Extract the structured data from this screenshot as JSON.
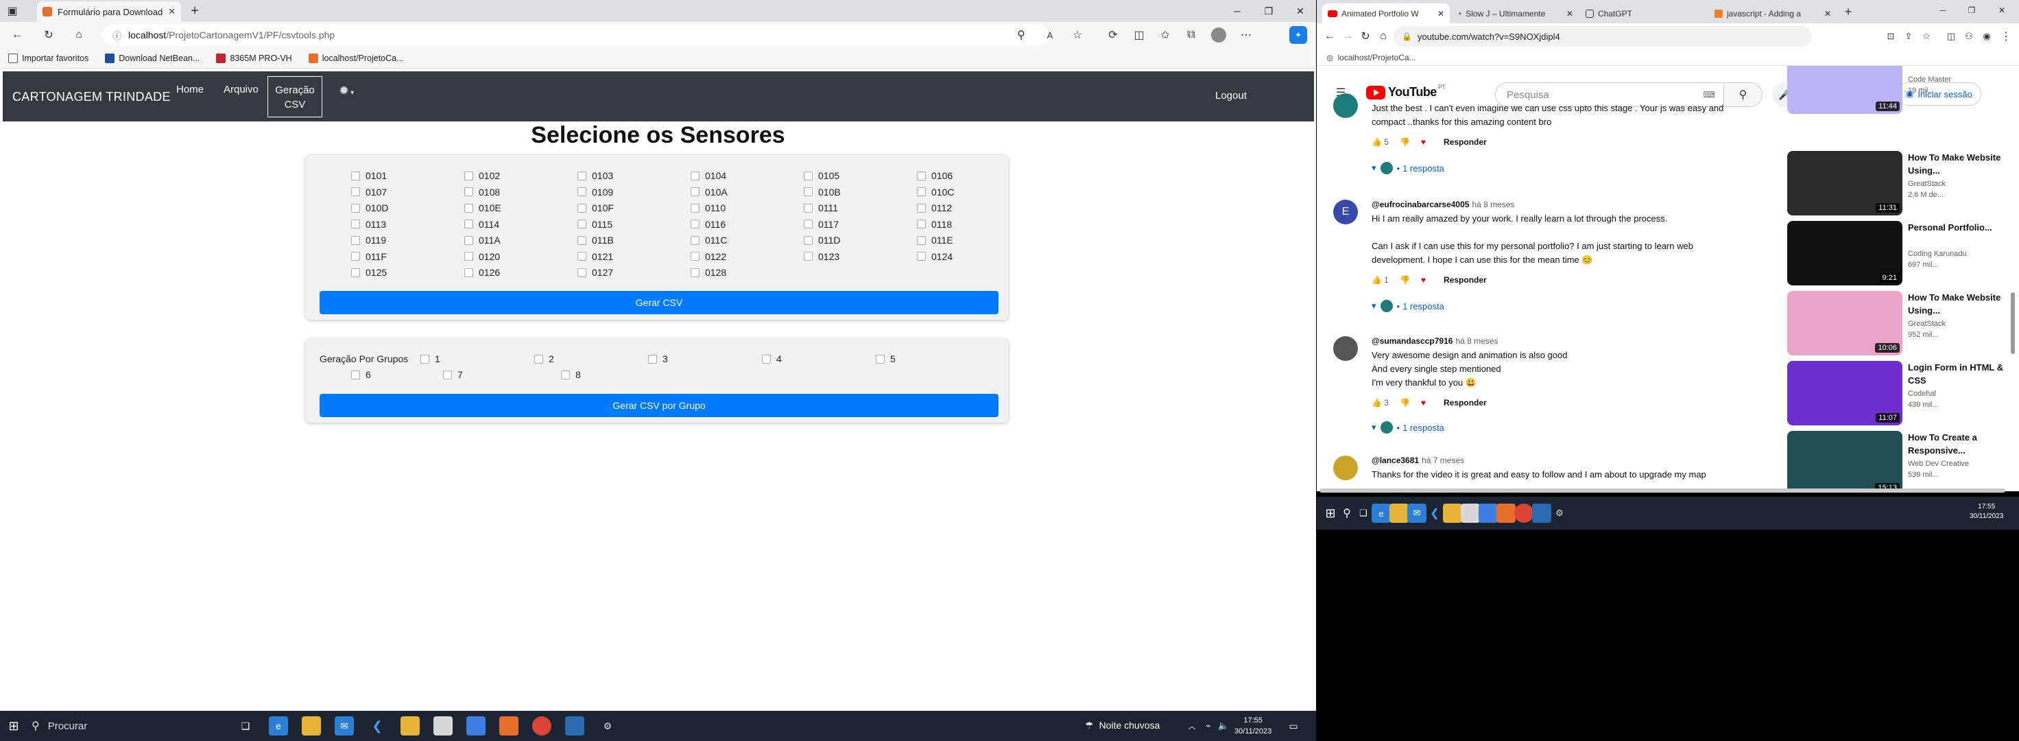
{
  "left_browser": {
    "tab_title": "Formulário para Download de CSV",
    "url_host": "localhost",
    "url_path": "/ProjetoCartonagemV1/PF/csvtools.php",
    "favorites": [
      {
        "label": "Importar favoritos"
      },
      {
        "label": "Download NetBean..."
      },
      {
        "label": "8365M PRO-VH"
      },
      {
        "label": "localhost/ProjetoCa..."
      }
    ]
  },
  "app": {
    "brand": "CARTONAGEM TRINDADE",
    "nav": {
      "home": "Home",
      "arquivo": "Arquivo",
      "geracao_line1": "Geração",
      "geracao_line2": "CSV",
      "logout": "Logout"
    },
    "title": "Selecione os Sensores",
    "sensors": [
      "0101",
      "0102",
      "0103",
      "0104",
      "0105",
      "0106",
      "0107",
      "0108",
      "0109",
      "010A",
      "010B",
      "010C",
      "010D",
      "010E",
      "010F",
      "0110",
      "0111",
      "0112",
      "0113",
      "0114",
      "0115",
      "0116",
      "0117",
      "0118",
      "0119",
      "011A",
      "011B",
      "011C",
      "011D",
      "011E",
      "011F",
      "0120",
      "0121",
      "0122",
      "0123",
      "0124",
      "0125",
      "0126",
      "0127",
      "0128"
    ],
    "gerar_csv": "Gerar CSV",
    "group_label": "Geração Por Grupos",
    "groups": [
      "1",
      "2",
      "3",
      "4",
      "5",
      "6",
      "7",
      "8"
    ],
    "gerar_csv_grupo": "Gerar CSV por Grupo"
  },
  "left_taskbar": {
    "search_placeholder": "Procurar",
    "weather": "Noite chuvosa",
    "time": "17:55",
    "date": "30/11/2023"
  },
  "right_browser": {
    "tabs": [
      {
        "title": "Animated Portfolio W"
      },
      {
        "title": "Slow J – Ultimamente"
      },
      {
        "title": "ChatGPT"
      },
      {
        "title": "javascript - Adding a"
      }
    ],
    "url": "youtube.com/watch?v=S9NOXjdipl4",
    "bookmark": "localhost/ProjetoCa..."
  },
  "youtube": {
    "logo_text": "YouTube",
    "region": "PT",
    "search_placeholder": "Pesquisa",
    "signin": "Iniciar sessão",
    "comments": [
      {
        "author": "",
        "time": "",
        "text": "Just the best . I can't even imagine we can use css upto this stage . Your js was easy and\ncompact ..thanks for this amazing content bro",
        "likes": "5",
        "reply_label": "Responder",
        "replies": "1 resposta"
      },
      {
        "author": "@eufrocinabarcarse4005",
        "time": "há 8 meses",
        "text": "Hi I am really amazed by your work. I really learn a lot through the process.\n\nCan I ask if I can use this for my personal portfolio? I am just starting to learn web\ndevelopment. I hope I can use this for the mean time 😊",
        "likes": "1",
        "reply_label": "Responder",
        "replies": "1 resposta"
      },
      {
        "author": "@sumandasccp7916",
        "time": "há 8 meses",
        "text": "Very awesome design and animation is also good\nAnd every single step mentioned\nI'm very thankful to you 😃",
        "likes": "3",
        "reply_label": "Responder",
        "replies": "1 resposta"
      },
      {
        "author": "@lance3681",
        "time": "há 7 meses",
        "text": "Thanks for the video it is great and easy to follow and I am about to upgrade my map",
        "likes": "",
        "reply_label": "",
        "replies": ""
      }
    ],
    "recommendations": [
      {
        "title": "",
        "channel": "Code Master",
        "views": "19 mil...",
        "duration": "11:44",
        "color": "#b9b4f5"
      },
      {
        "title": "How To Make Website Using...",
        "channel": "GreatStack",
        "views": "2,6 M de...",
        "duration": "11:31",
        "color": "#2b2b2b"
      },
      {
        "title": "Personal Portfolio...",
        "channel": "Coding Karunadu",
        "views": "697 mil...",
        "duration": "9:21",
        "color": "#111111"
      },
      {
        "title": "How To Make Website Using...",
        "channel": "GreatStack",
        "views": "952 mil...",
        "duration": "10:06",
        "color": "#e9a4c7"
      },
      {
        "title": "Login Form in HTML & CSS",
        "channel": "Codehal",
        "views": "439 mil...",
        "duration": "11:07",
        "color": "#6f2fcf"
      },
      {
        "title": "How To Create a Responsive...",
        "channel": "Web Dev Creative",
        "views": "539 mil...",
        "duration": "15:13",
        "color": "#1f4f52"
      }
    ]
  },
  "right_taskbar": {
    "time": "17:55",
    "date": "30/11/2023"
  }
}
